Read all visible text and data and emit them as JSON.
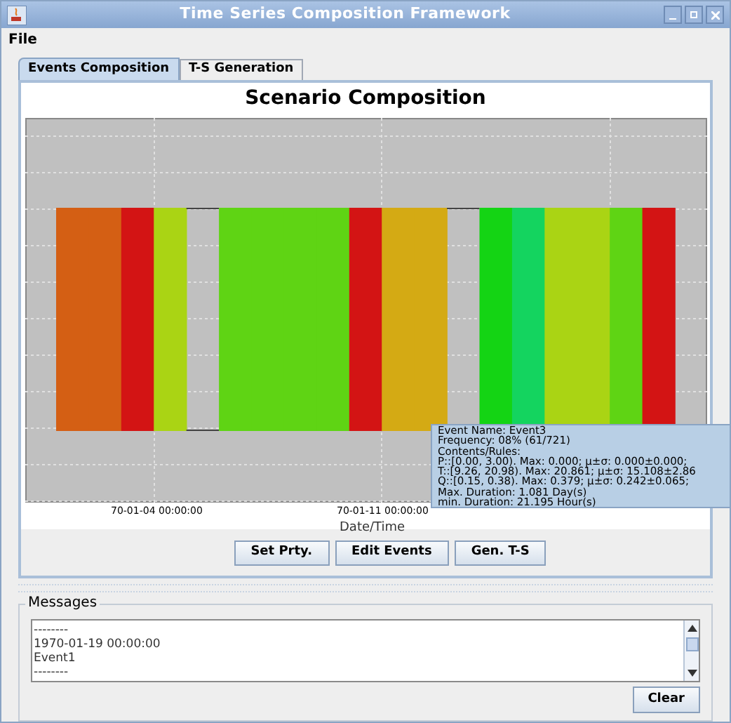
{
  "window": {
    "title": "Time Series Composition Framework"
  },
  "menu": [
    "File"
  ],
  "tabs": [
    {
      "label": "Events Composition",
      "selected": true
    },
    {
      "label": "T-S Generation",
      "selected": false
    }
  ],
  "chart": {
    "title": "Scenario Composition",
    "xlabel": "Date/Time",
    "xtick_labels": [
      "70-01-04 00:00:00",
      "70-01-11 00:00:00"
    ],
    "segments": [
      {
        "kind": "event",
        "color": "#d45f14"
      },
      {
        "kind": "event",
        "color": "#d45f14"
      },
      {
        "kind": "event",
        "color": "#d31414"
      },
      {
        "kind": "event",
        "color": "#aad414"
      },
      {
        "kind": "gap"
      },
      {
        "kind": "event",
        "color": "#5fd414"
      },
      {
        "kind": "event",
        "color": "#5fd414"
      },
      {
        "kind": "event",
        "color": "#5fd414"
      },
      {
        "kind": "event",
        "color": "#5fd414"
      },
      {
        "kind": "event",
        "color": "#d31414"
      },
      {
        "kind": "event",
        "color": "#d4aa14"
      },
      {
        "kind": "event",
        "color": "#d4aa14"
      },
      {
        "kind": "gap"
      },
      {
        "kind": "event",
        "color": "#14d414"
      },
      {
        "kind": "event",
        "color": "#14d45f"
      },
      {
        "kind": "event",
        "color": "#aad414"
      },
      {
        "kind": "event",
        "color": "#aad414"
      },
      {
        "kind": "event",
        "color": "#5fd414"
      },
      {
        "kind": "event",
        "color": "#d31414"
      }
    ]
  },
  "tooltip": [
    "Event Name: Event3",
    "Frequency: 08% (61/721)",
    "Contents/Rules:",
    "P::[0.00, 3.00). Max: 0.000; µ±σ: 0.000±0.000;",
    "T::[9.26, 20.98). Max: 20.861; µ±σ: 15.108±2.86",
    "Q::[0.15, 0.38). Max: 0.379; µ±σ: 0.242±0.065;",
    "Max. Duration: 1.081 Day(s)",
    "min. Duration: 21.195 Hour(s)"
  ],
  "buttons": [
    "Set Prty.",
    "Edit Events",
    "Gen. T-S"
  ],
  "messages": {
    "title": "Messages",
    "lines": [
      "--------",
      "1970-01-19 00:00:00",
      "Event1",
      "--------"
    ],
    "clear_button": "Clear"
  }
}
